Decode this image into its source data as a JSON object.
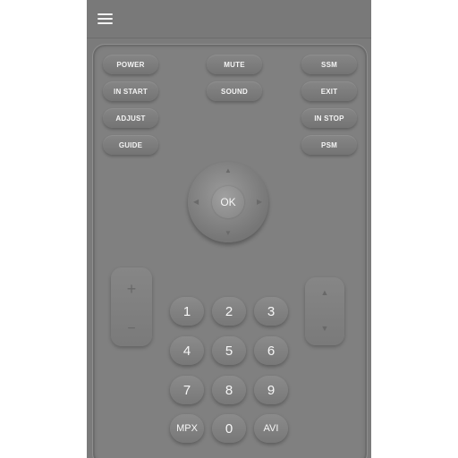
{
  "menu": {
    "icon": "hamburger-menu-icon"
  },
  "function_buttons": {
    "power": "POWER",
    "mute": "MUTE",
    "ssm": "SSM",
    "in_start": "IN START",
    "sound": "SOUND",
    "exit": "EXIT",
    "adjust": "ADJUST",
    "in_stop": "IN STOP",
    "guide": "GUIDE",
    "psm": "PSM"
  },
  "dpad": {
    "ok": "OK",
    "up": "▲",
    "down": "▼",
    "left": "◀",
    "right": "▶"
  },
  "volume": {
    "plus": "+",
    "minus": "−"
  },
  "channel": {
    "up": "▲",
    "down": "▼"
  },
  "numpad": {
    "k1": "1",
    "k2": "2",
    "k3": "3",
    "k4": "4",
    "k5": "5",
    "k6": "6",
    "k7": "7",
    "k8": "8",
    "k9": "9",
    "mpx": "MPX",
    "k0": "0",
    "avi": "AVI"
  },
  "colors": {
    "app_background": "#7b7b7b",
    "button_text": "#f4f4f4"
  }
}
